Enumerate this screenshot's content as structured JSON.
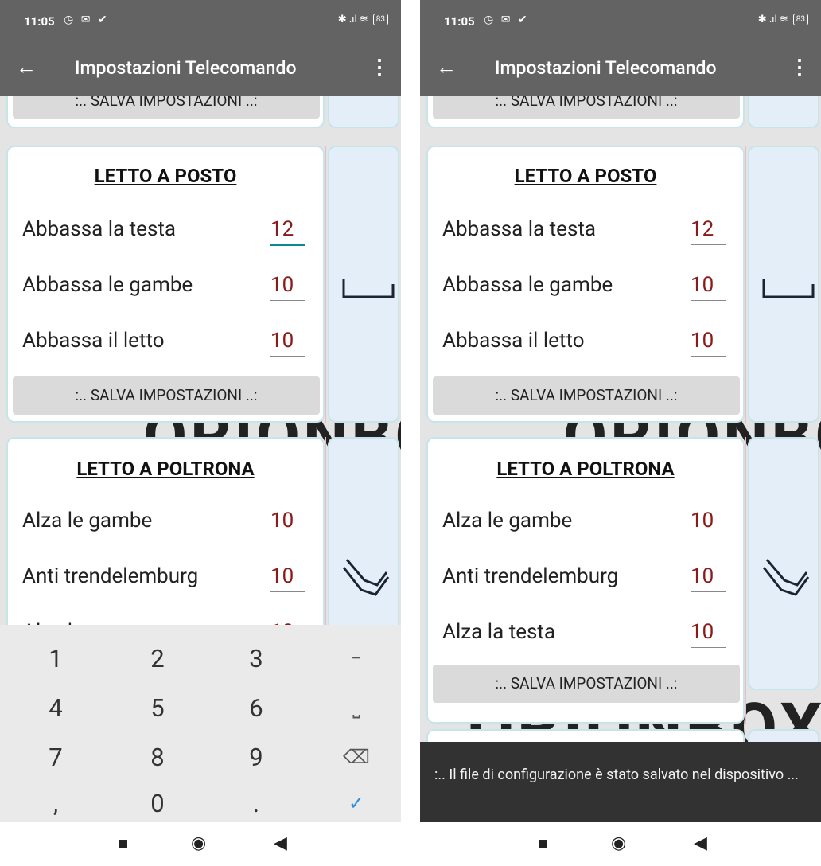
{
  "status": {
    "time": "11:05",
    "left_icons": "◷ ✉ ✔",
    "right_icons": "✱ .ıl ≋",
    "battery": "83"
  },
  "toolbar": {
    "back": "←",
    "title": "Impostazioni Telecomando",
    "menu": "⋮"
  },
  "save_label": ":.. SALVA IMPOSTAZIONI ..:",
  "logo_text": "ORIONBOX",
  "posto": {
    "title": "LETTO A POSTO",
    "rows": [
      {
        "label": "Abbassa la testa",
        "value": "12"
      },
      {
        "label": "Abbassa le gambe",
        "value": "10"
      },
      {
        "label": "Abbassa il letto",
        "value": "10"
      }
    ]
  },
  "poltrona": {
    "title": "LETTO A POLTRONA",
    "rows": [
      {
        "label": "Alza le gambe",
        "value": "10"
      },
      {
        "label": "Anti trendelemburg",
        "value": "10"
      },
      {
        "label": "Alza la testa",
        "value": "10"
      }
    ]
  },
  "keyboard": {
    "keys": [
      "1",
      "2",
      "3",
      "−",
      "4",
      "5",
      "6",
      "⎵",
      "7",
      "8",
      "9",
      "⌫",
      ",",
      "0",
      ".",
      "✓"
    ]
  },
  "snackbar": ":.. Il file di configurazione è stato salvato nel dispositivo ...",
  "navbar": {
    "recent": "■",
    "home": "◉",
    "back": "◀"
  }
}
